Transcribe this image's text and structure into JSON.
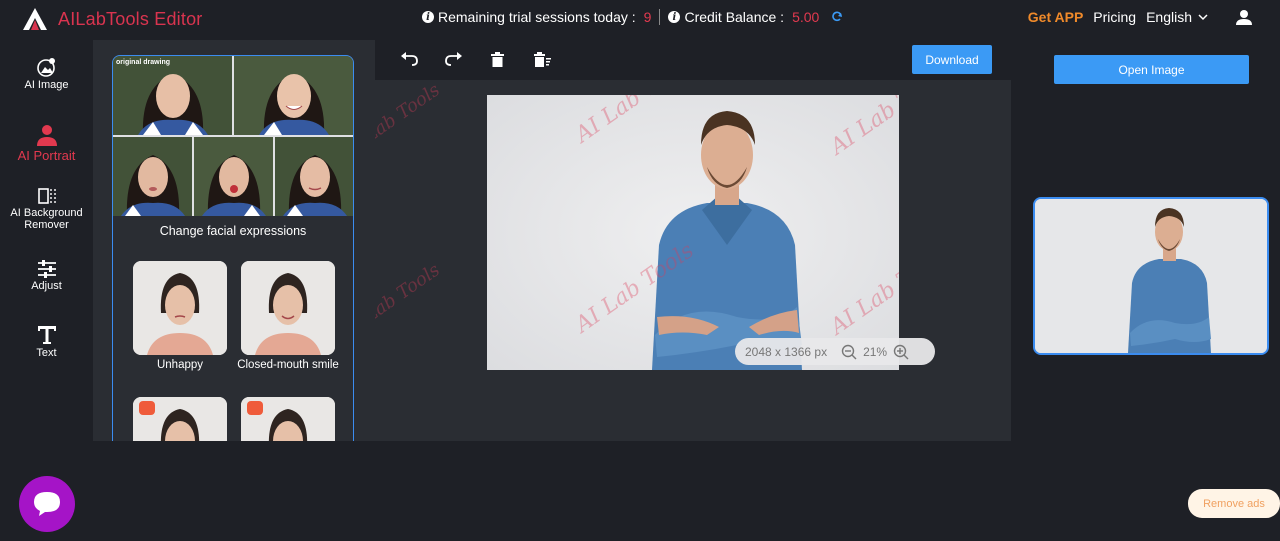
{
  "app": {
    "title": "AILabTools Editor",
    "brand_color": "#d9344f",
    "accent_color": "#3b9af5"
  },
  "header": {
    "trial_label": "Remaining trial sessions today :",
    "trial_value": "9",
    "credit_label": "Credit Balance :",
    "credit_value": "5.00",
    "get_app": "Get APP",
    "pricing": "Pricing",
    "language": "English"
  },
  "sidebar": {
    "items": [
      {
        "label": "AI Image",
        "icon": "ai-image-icon"
      },
      {
        "label": "AI Portrait",
        "icon": "portrait-icon",
        "active": true
      },
      {
        "label_line1": "AI Background",
        "label_line2": "Remover",
        "icon": "background-remover-icon"
      },
      {
        "label": "Adjust",
        "icon": "sliders-icon"
      },
      {
        "label": "Text",
        "icon": "text-icon"
      }
    ]
  },
  "panel": {
    "original_label": "original drawing",
    "section_title": "Change facial expressions",
    "styles": [
      {
        "label": "Unhappy"
      },
      {
        "label": "Closed-mouth smile"
      },
      {
        "label": "",
        "premium": true
      },
      {
        "label": "",
        "premium": true
      }
    ]
  },
  "toolbar": {
    "download_label": "Download"
  },
  "canvas": {
    "watermark": "AI Lab Tools",
    "dimensions": "2048 x 1366 px",
    "zoom": "21%"
  },
  "right": {
    "open_image_label": "Open Image"
  },
  "footer": {
    "remove_ads": "Remove ads"
  }
}
